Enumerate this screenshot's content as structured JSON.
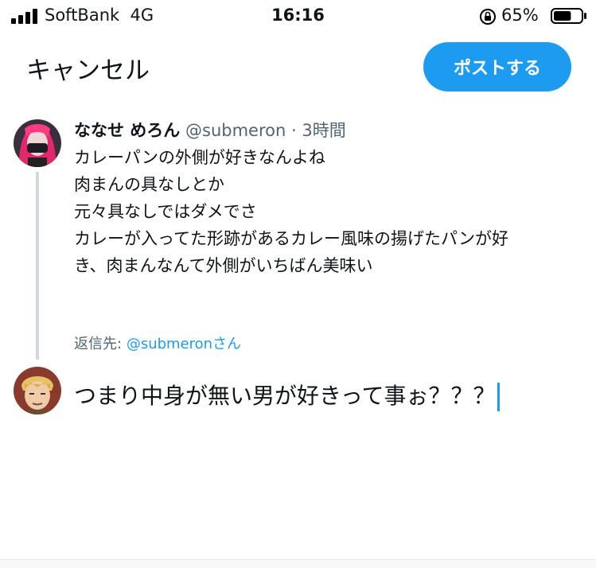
{
  "status_bar": {
    "carrier": "SoftBank",
    "network": "4G",
    "time": "16:16",
    "battery_percent": "65%",
    "battery_level": 0.65
  },
  "header": {
    "cancel_label": "キャンセル",
    "post_label": "ポストする",
    "accent_color": "#1d9bf0"
  },
  "tweet": {
    "display_name": "ななせ めろん",
    "handle": "@submeron",
    "separator": "·",
    "time_ago": "3時間",
    "lines": [
      "カレーパンの外側が好きなんよね",
      "肉まんの具なしとか",
      "元々具なしではダメでさ",
      "カレーが入ってた形跡があるカレー風味の揚げたパンが好",
      "き、肉まんなんて外側がいちばん美味い"
    ]
  },
  "reply": {
    "prefix": "返信先:",
    "handle": "@submeronさん"
  },
  "compose": {
    "text": "つまり中身が無い男が好きって事ぉ？？？"
  }
}
